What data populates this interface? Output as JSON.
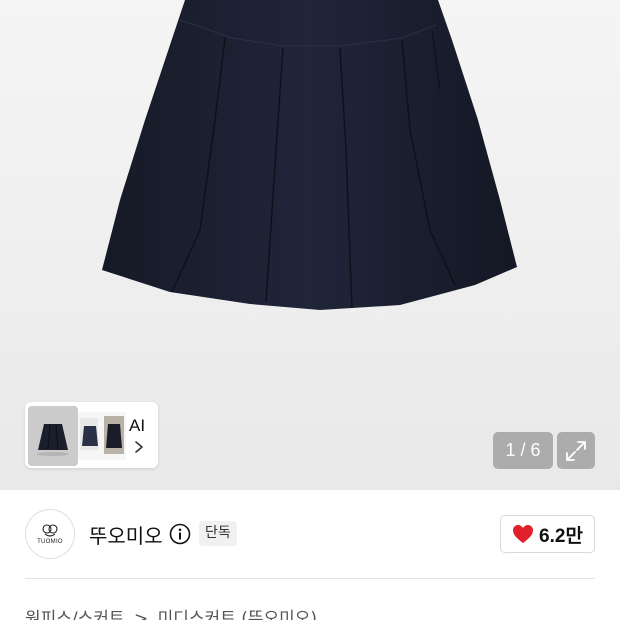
{
  "gallery": {
    "page_counter": "1 / 6",
    "similar_label": "AI",
    "icons": {
      "expand": "expand-icon",
      "chevron": "chevron-right-icon"
    }
  },
  "brand": {
    "name": "뚜오미오",
    "logo_text": "TUOMIO",
    "badge": "단독",
    "likes": "6.2만",
    "like_color": "#e0212b"
  },
  "breadcrumb": {
    "category": "원피스/스커트",
    "separator": ">",
    "subcategory": "미디스커트 (뚜오미오)"
  },
  "colors": {
    "skirt": "#1b1f2b",
    "overlay": "#8a8a8a"
  }
}
